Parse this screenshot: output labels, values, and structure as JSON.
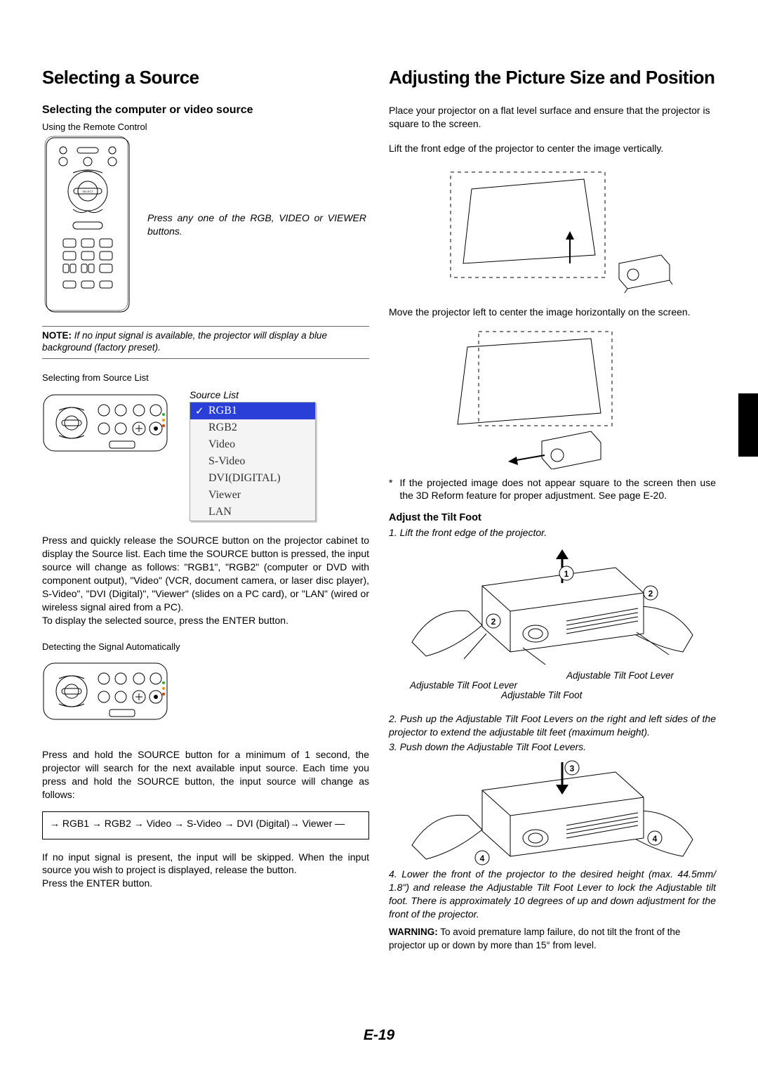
{
  "left": {
    "h1": "Selecting a Source",
    "h2": "Selecting the computer or video source",
    "using": "Using the Remote Control",
    "remote_caption": "Press any one of the RGB, VIDEO or VIEWER buttons.",
    "note_lead": "NOTE:",
    "note": " If no input signal is available, the projector will display a blue background (factory preset).",
    "selecting_from": "Selecting from Source List",
    "source_list_label": "Source List",
    "source_items": [
      "RGB1",
      "RGB2",
      "Video",
      "S-Video",
      "DVI(DIGITAL)",
      "Viewer",
      "LAN"
    ],
    "para1": "Press and quickly release the SOURCE button on the projector cabinet to display the Source list. Each time the SOURCE button is pressed, the input source will change as follows: \"RGB1\", \"RGB2\" (computer or DVD with component output), \"Video\" (VCR, document camera, or laser disc player), S-Video\", \"DVI (Digital)\", \"Viewer\" (slides on a PC card), or \"LAN\" (wired or wireless signal aired from a PC).",
    "para1b": "To display the selected source, press the ENTER button.",
    "detecting": "Detecting the Signal Automatically",
    "para2": "Press and hold the SOURCE button for a minimum of 1 second, the projector will search for the next available input source. Each time you press and hold the SOURCE button, the input source will change as follows:",
    "flow": "→ RGB1 → RGB2 → Video → S-Video → DVI (Digital)→ Viewer —",
    "para3": "If no input signal is present, the input will be skipped. When the input source you wish to project is displayed, release the button.",
    "para3b": "Press the ENTER button."
  },
  "right": {
    "h1": "Adjusting the Picture Size and Position",
    "p1": "Place your projector on a flat level surface and ensure that the projector is square to the screen.",
    "p2": "Lift the front edge of the projector to center the image vertically.",
    "p3": "Move the projector left to center the image horizontally on the screen.",
    "bullet": "If the projected image does not appear square to the screen then use the 3D Reform feature for proper adjustment. See page E-20.",
    "h3": "Adjust the Tilt Foot",
    "step1": "1. Lift the front edge of the projector.",
    "lbl_lever_r": "Adjustable Tilt Foot Lever",
    "lbl_lever_l": "Adjustable Tilt Foot Lever",
    "lbl_foot": "Adjustable Tilt Foot",
    "step2": "2. Push up the Adjustable Tilt Foot Levers on the right and left sides of the projector to extend the adjustable tilt feet (maximum height).",
    "step3": "3. Push down the Adjustable Tilt Foot Levers.",
    "step4": "4. Lower the front of the projector to the desired height (max. 44.5mm/ 1.8\") and release the Adjustable Tilt Foot Lever to lock the Adjustable tilt foot. There is approximately 10 degrees of up and down adjustment for the front of the projector.",
    "warn_lead": "WARNING:",
    "warn": " To avoid premature lamp failure, do not tilt the front of the projector up or down by more than 15° from level."
  },
  "page_num": "E-19"
}
